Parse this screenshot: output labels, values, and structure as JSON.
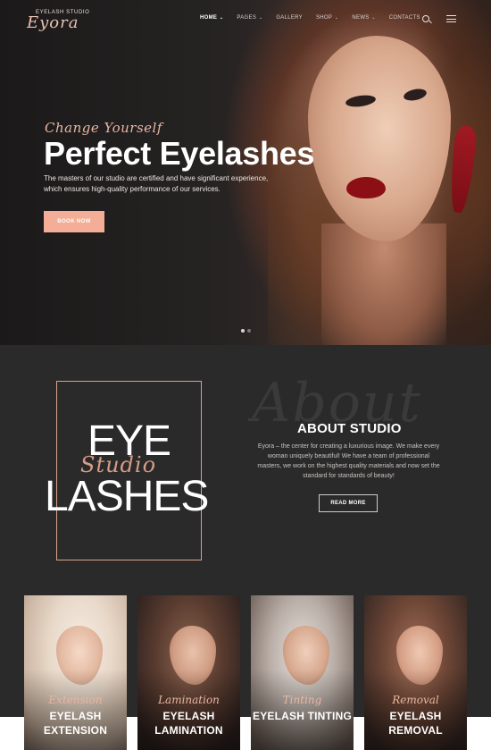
{
  "header": {
    "logo_small": "EYELASH STUDIO",
    "logo_script": "Eyora",
    "nav": [
      {
        "label": "HOME",
        "dropdown": true
      },
      {
        "label": "PAGES",
        "dropdown": true
      },
      {
        "label": "GALLERY",
        "dropdown": false
      },
      {
        "label": "SHOP",
        "dropdown": true
      },
      {
        "label": "NEWS",
        "dropdown": true
      },
      {
        "label": "CONTACTS",
        "dropdown": false
      }
    ],
    "active_nav": "HOME",
    "search_icon": "search-icon",
    "menu_icon": "hamburger-menu-icon"
  },
  "hero": {
    "script": "Change Yourself",
    "title": "Perfect Eyelashes",
    "text": "The masters of our studio are certified and have significant experience, which ensures high-quality performance of our services.",
    "button": "BOOK NOW",
    "slides": 2,
    "active_slide": 1
  },
  "about": {
    "word_eye": "EYE",
    "word_studio": "Studio",
    "word_lashes": "LASHES",
    "watermark": "About",
    "title": "ABOUT STUDIO",
    "text": "Eyora – the center for creating a luxurious image. We make every woman uniquely beautiful! We have a team of professional masters, we work on the highest quality materials and now set the standard for standards of beauty!",
    "button": "READ MORE"
  },
  "services": [
    {
      "script": "Extension",
      "title_line1": "EYELASH",
      "title_line2": "EXTENSION"
    },
    {
      "script": "Lamination",
      "title_line1": "EYELASH",
      "title_line2": "LAMINATION"
    },
    {
      "script": "Tinting",
      "title_line1": "EYELASH TINTING",
      "title_line2": ""
    },
    {
      "script": "Removal",
      "title_line1": "EYELASH",
      "title_line2": "REMOVAL"
    }
  ],
  "colors": {
    "accent": "#f4ad96",
    "frame": "#d8a28d",
    "dark_bg": "#2b2a2a"
  }
}
